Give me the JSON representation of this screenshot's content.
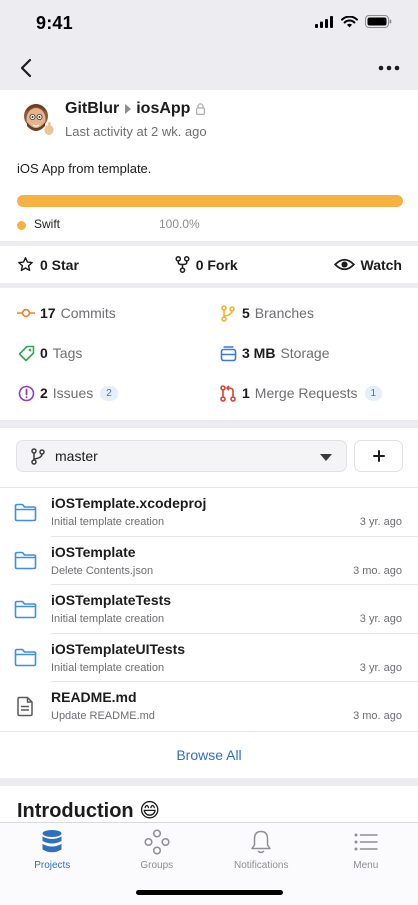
{
  "status_bar": {
    "time": "9:41"
  },
  "project": {
    "owner": "GitBlur",
    "name": "iosApp",
    "last_activity": "Last activity at 2 wk. ago",
    "description": "iOS App from template.",
    "language": {
      "name": "Swift",
      "percent_text": "100.0%",
      "fraction": 1.0,
      "color": "#f7b141"
    }
  },
  "actions": {
    "star": "0 Star",
    "fork": "0 Fork",
    "watch": "Watch"
  },
  "stats": {
    "commits": {
      "count": "17",
      "label": "Commits"
    },
    "branches": {
      "count": "5",
      "label": "Branches"
    },
    "tags": {
      "count": "0",
      "label": "Tags"
    },
    "storage": {
      "count": "3 MB",
      "label": "Storage"
    },
    "issues": {
      "count": "2",
      "label": "Issues",
      "badge": "2"
    },
    "merge_requests": {
      "count": "1",
      "label": "Merge Requests",
      "badge": "1"
    }
  },
  "branch": {
    "name": "master",
    "add_label": "+"
  },
  "files": [
    {
      "name": "iOSTemplate.xcodeproj",
      "message": "Initial template creation",
      "time": "3 yr. ago",
      "type": "folder"
    },
    {
      "name": "iOSTemplate",
      "message": "Delete Contents.json",
      "time": "3 mo. ago",
      "type": "folder"
    },
    {
      "name": "iOSTemplateTests",
      "message": "Initial template creation",
      "time": "3 yr. ago",
      "type": "folder"
    },
    {
      "name": "iOSTemplateUITests",
      "message": "Initial template creation",
      "time": "3 yr. ago",
      "type": "folder"
    },
    {
      "name": "README.md",
      "message": "Update README.md",
      "time": "3 mo. ago",
      "type": "file"
    }
  ],
  "browse_all": "Browse All",
  "readme": {
    "title": "Introduction 😄"
  },
  "tabs": [
    {
      "label": "Projects",
      "icon": "database-icon",
      "active": true
    },
    {
      "label": "Groups",
      "icon": "groups-icon",
      "active": false
    },
    {
      "label": "Notifications",
      "icon": "bell-icon",
      "active": false
    },
    {
      "label": "Menu",
      "icon": "menu-icon",
      "active": false
    }
  ],
  "colors": {
    "accent": "#2f6fbf",
    "commits": "#e8822e",
    "branches": "#f0b429",
    "tags": "#2fa84f",
    "storage": "#3d7ad6",
    "issues": "#8a3fc2",
    "merge_requests": "#d9432f"
  }
}
